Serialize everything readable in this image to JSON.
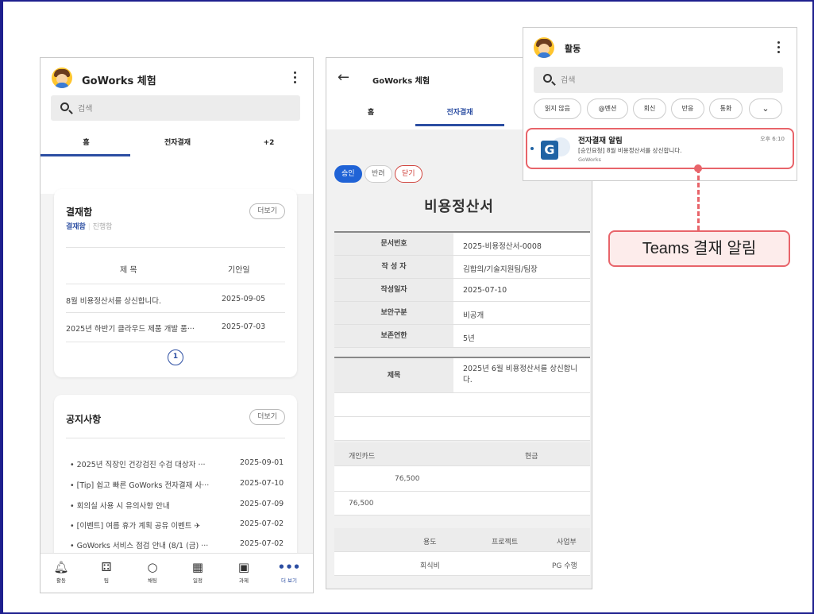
{
  "phone1": {
    "header": {
      "title": "GoWorks 체험"
    },
    "search": {
      "placeholder": "검색"
    },
    "tabs": [
      {
        "label": "홈"
      },
      {
        "label": "전자결재"
      },
      {
        "label": "+2"
      }
    ],
    "approval_card": {
      "title": "결재함",
      "more": "더보기",
      "subtabs": [
        "결재함",
        "진행함"
      ],
      "columns": [
        "제 목",
        "기안일"
      ],
      "rows": [
        {
          "title": "8월 비용정산서를 상신합니다.",
          "date": "2025-09-05"
        },
        {
          "title": "2025년 하반기 클라우드 제품 개발 품···",
          "date": "2025-07-03"
        }
      ],
      "page": "1"
    },
    "notice_card": {
      "title": "공지사항",
      "more": "더보기",
      "rows": [
        {
          "title": "2025년 직장인 건강검진 수검 대상자 ···",
          "date": "2025-09-01"
        },
        {
          "title": "[Tip] 쉽고 빠른 GoWorks 전자결재 사···",
          "date": "2025-07-10"
        },
        {
          "title": "회의실 사용 시 유의사항 안내",
          "date": "2025-07-09"
        },
        {
          "title": "[이벤트] 여름 휴가 계획 공유 이벤트 ✈",
          "date": "2025-07-02"
        },
        {
          "title": "GoWorks 서비스 점검 안내 (8/1 (금) ···",
          "date": "2025-07-02"
        }
      ]
    },
    "nav": [
      {
        "icon": "bell-icon",
        "label": "활동"
      },
      {
        "icon": "team-icon",
        "label": "팀"
      },
      {
        "icon": "chat-icon",
        "label": "채팅"
      },
      {
        "icon": "calendar-icon",
        "label": "일정"
      },
      {
        "icon": "assignment-icon",
        "label": "과제"
      },
      {
        "icon": "more-icon",
        "label": "더 보기"
      }
    ]
  },
  "phone2": {
    "header": {
      "title": "GoWorks 체험"
    },
    "tabs": [
      {
        "label": "홈"
      },
      {
        "label": "전자결재"
      }
    ],
    "actions": [
      "승인",
      "반려",
      "닫기"
    ],
    "doc_title": "비용정산서",
    "fields": [
      {
        "key": "문서번호",
        "value": "2025-비용정산서-0008"
      },
      {
        "key": "작 성 자",
        "value": "김합의/기술지원팀/팀장"
      },
      {
        "key": "작성일자",
        "value": "2025-07-10"
      },
      {
        "key": "보안구분",
        "value": "비공개"
      },
      {
        "key": "보존연한",
        "value": "5년"
      }
    ],
    "subject": {
      "key": "제목",
      "value": "2025년 6월 비용정산서를 상신합니다."
    },
    "pay_table": {
      "card_label": "개인카드",
      "cash_label": "현금",
      "card_amount": "76,500",
      "total": "76,500"
    },
    "detail_table": {
      "cols": [
        "용도",
        "프로젝트",
        "사업부"
      ],
      "values": [
        "회식비",
        "",
        "PG 수행"
      ]
    }
  },
  "activity": {
    "title": "활동",
    "search_placeholder": "검색",
    "filters": [
      "읽지 않음",
      "@멘션",
      "회신",
      "반응",
      "통화"
    ],
    "notification": {
      "title": "전자결재 알림",
      "body": "[승인요청] 8월 비용정산서를 상신합니다.",
      "source": "GoWorks",
      "time": "오후 6:10",
      "logo_letter": "G"
    }
  },
  "callout": {
    "label": "Teams 결재 알림"
  }
}
